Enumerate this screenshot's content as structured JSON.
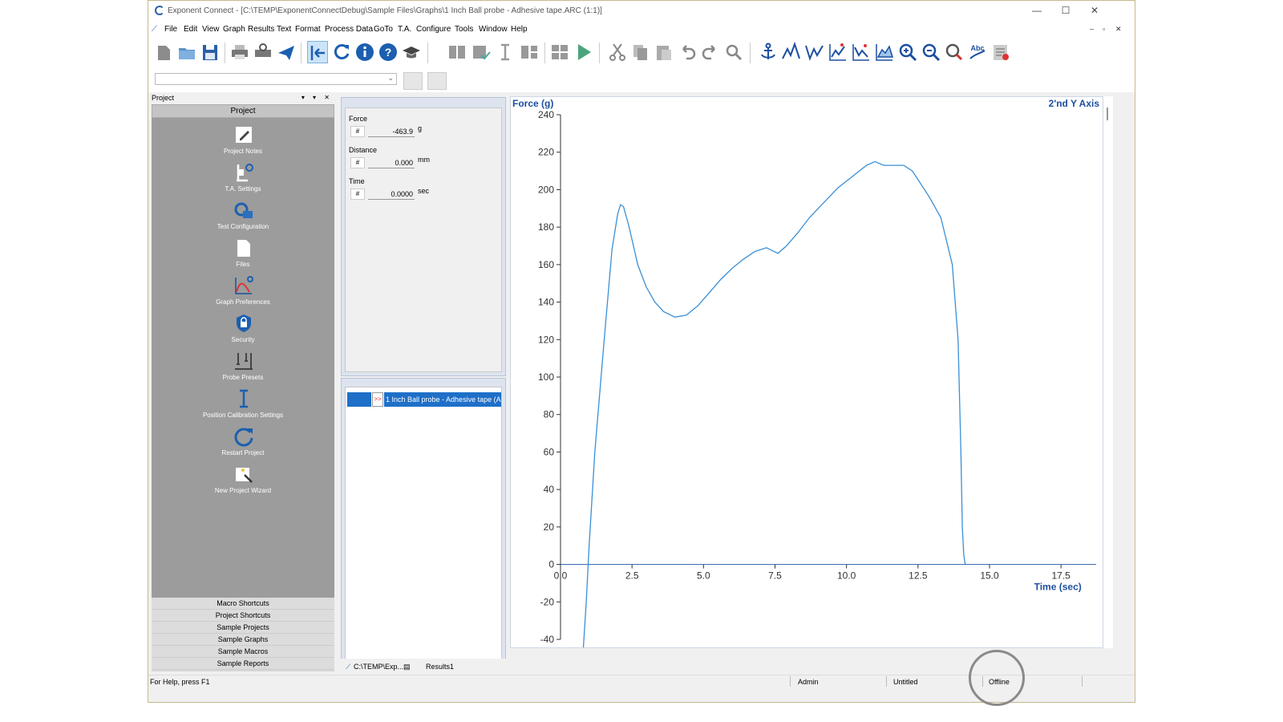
{
  "window": {
    "title": "Exponent Connect - [C:\\TEMP\\ExponentConnectDebug\\Sample Files\\Graphs\\1 Inch Ball probe - Adhesive tape.ARC (1:1)]",
    "minimize": "—",
    "maximize": "☐",
    "close": "✕"
  },
  "menu": {
    "items": [
      "File",
      "Edit",
      "View",
      "Graph",
      "Results",
      "Text",
      "Format",
      "Process Data",
      "GoTo",
      "T.A.",
      "Configure",
      "Tools",
      "Window",
      "Help"
    ],
    "mdi_controls": [
      "–",
      "▫",
      "✕"
    ]
  },
  "toolbar": {
    "icons": [
      "new-icon",
      "open-folder-icon",
      "save-icon",
      "print-icon",
      "print-preview-icon",
      "send-icon",
      "arrow-left-icon",
      "refresh-icon",
      "info-icon",
      "help-icon",
      "graduation-cap-icon",
      "import-icon",
      "export-check-icon",
      "vertical-measure-icon",
      "split-icon",
      "grid-icon",
      "run-icon",
      "cut-icon",
      "copy-icon",
      "paste-icon",
      "undo-icon",
      "redo-icon",
      "find-icon",
      "anchor-icon",
      "peak-icon",
      "valley-icon",
      "graph-marker-icon",
      "graph-marker2-icon",
      "graph-area-icon",
      "zoom-in-icon",
      "zoom-out-icon",
      "highlighter-icon",
      "spell-check-icon",
      "settings-list-icon"
    ]
  },
  "combo": {
    "value": ""
  },
  "project_panel": {
    "header": "Project",
    "pin_controls": "▾ ▾ ✕",
    "caption": "Project",
    "items": [
      {
        "label": "Project Notes",
        "icon": "notes-icon"
      },
      {
        "label": "T.A. Settings",
        "icon": "ta-settings-icon"
      },
      {
        "label": "Test Configuration",
        "icon": "test-config-icon"
      },
      {
        "label": "Files",
        "icon": "files-icon"
      },
      {
        "label": "Graph Preferences",
        "icon": "graph-preferences-icon"
      },
      {
        "label": "Security",
        "icon": "security-lock-icon"
      },
      {
        "label": "Probe Presets",
        "icon": "probe-presets-icon"
      },
      {
        "label": "Position Calibration Settings",
        "icon": "position-calibration-icon"
      },
      {
        "label": "Restart Project",
        "icon": "restart-icon"
      },
      {
        "label": "New Project Wizard",
        "icon": "wizard-icon"
      }
    ],
    "links": [
      "Macro Shortcuts",
      "Project Shortcuts",
      "Sample Projects",
      "Sample Graphs",
      "Sample Macros",
      "Sample Reports"
    ]
  },
  "readouts": [
    {
      "name": "Force",
      "hash": "#",
      "value": "-463.9",
      "unit": "g"
    },
    {
      "name": "Distance",
      "hash": "#",
      "value": "0.000",
      "unit": "mm"
    },
    {
      "name": "Time",
      "hash": "#",
      "value": "0.0000",
      "unit": "sec"
    }
  ],
  "file_list": {
    "rows": [
      {
        "arrows": ">>",
        "name": "1 Inch Ball probe - Adhesive tape (A"
      }
    ]
  },
  "colors": {
    "series": "#3a8fd6",
    "axis_title": "#1c4fa0",
    "selection": "#1e6fc8"
  },
  "chart_data": {
    "type": "line",
    "ylabel": "Force (g)",
    "xlabel": "Time (sec)",
    "secondary_axis_label": "2'nd Y Axis",
    "xlim": [
      0,
      18
    ],
    "ylim": [
      -40,
      240
    ],
    "xticks": [
      "0.0",
      "2.5",
      "5.0",
      "7.5",
      "10.0",
      "12.5",
      "15.0",
      "17.5"
    ],
    "xtick_values": [
      0,
      2.5,
      5,
      7.5,
      10,
      12.5,
      15,
      17.5
    ],
    "yticks": [
      "240",
      "220",
      "200",
      "180",
      "160",
      "140",
      "120",
      "100",
      "80",
      "60",
      "40",
      "20",
      "0",
      "-20",
      "-40"
    ],
    "ytick_values": [
      240,
      220,
      200,
      180,
      160,
      140,
      120,
      100,
      80,
      60,
      40,
      20,
      0,
      -20,
      -40
    ],
    "grid": false,
    "series": [
      {
        "x": [
          0.8,
          0.9,
          1.0,
          1.2,
          1.5,
          1.8,
          2.0,
          2.1,
          2.2,
          2.4,
          2.7,
          3.0,
          3.3,
          3.6,
          4.0,
          4.4,
          4.8,
          5.2,
          5.6,
          6.0,
          6.4,
          6.8,
          7.2,
          7.6,
          7.9,
          8.3,
          8.7,
          9.2,
          9.7,
          10.2,
          10.7,
          11.0,
          11.3,
          11.7,
          12.0,
          12.3,
          12.6,
          12.9,
          13.3,
          13.7,
          13.9,
          14.0,
          14.05,
          14.1,
          14.15
        ],
        "y": [
          -45,
          -20,
          10,
          60,
          115,
          168,
          187,
          192,
          191,
          180,
          160,
          148,
          140,
          135,
          132,
          133,
          138,
          145,
          152,
          158,
          163,
          167,
          169,
          166,
          170,
          177,
          185,
          193,
          201,
          207,
          213,
          215,
          213,
          213,
          213,
          210,
          203,
          196,
          185,
          160,
          120,
          60,
          20,
          5,
          0
        ]
      }
    ]
  },
  "bottom_tabs": [
    "C:\\TEMP\\Exp...",
    "Results1"
  ],
  "status": {
    "help": "For Help, press F1",
    "user": "Admin",
    "doc": "Untitled",
    "connection": "Offline"
  }
}
